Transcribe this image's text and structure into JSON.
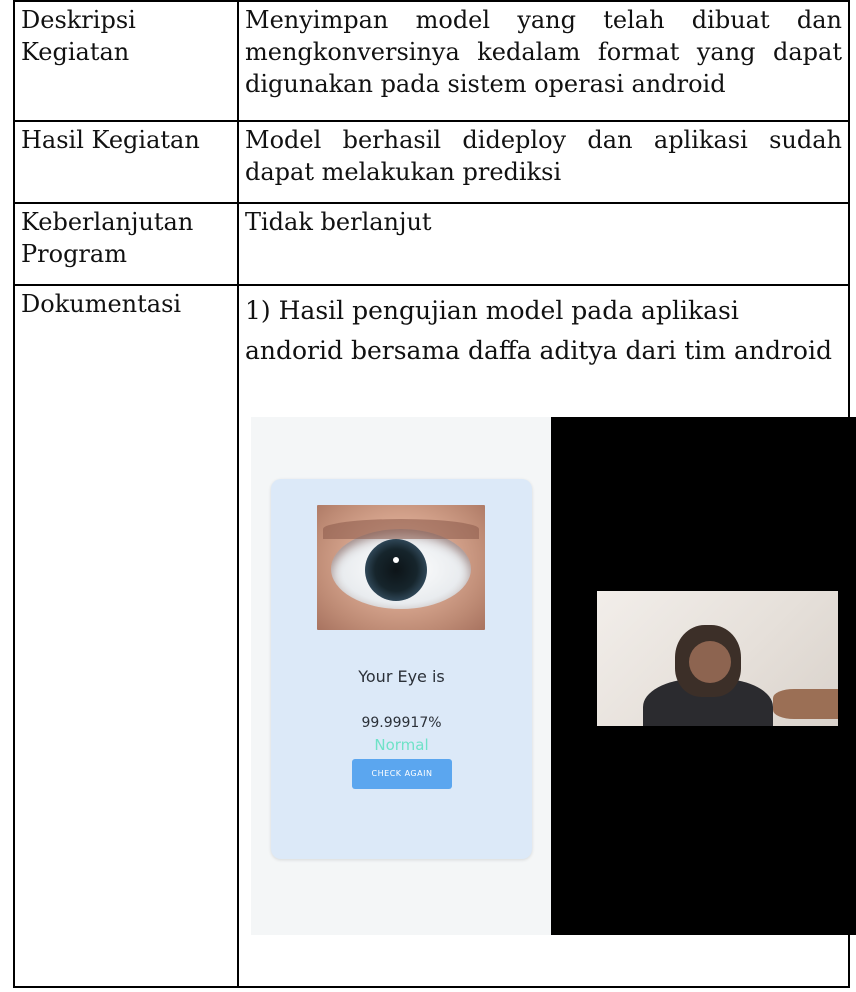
{
  "rows": [
    {
      "label": "Deskripsi Kegiatan",
      "content": "Menyimpan model yang telah dibuat dan mengkonversinya kedalam format yang dapat digunakan pada sistem operasi android"
    },
    {
      "label": "Hasil Kegiatan",
      "content": "Model berhasil dideploy dan aplikasi sudah dapat melakukan prediksi"
    },
    {
      "label": "Keberlanjutan Program",
      "content": "Tidak berlanjut"
    },
    {
      "label": "Dokumentasi",
      "content": "1) Hasil pengujian model pada aplikasi andorid bersama daffa aditya dari tim android"
    }
  ],
  "app_screen": {
    "eye_label": "Your Eye is",
    "confidence": "99.99917%",
    "status": "Normal",
    "check_button": "CHECK AGAIN",
    "status_color": "#6fe2c7",
    "button_color": "#5ba6ef",
    "card_color": "#dce9f8"
  }
}
